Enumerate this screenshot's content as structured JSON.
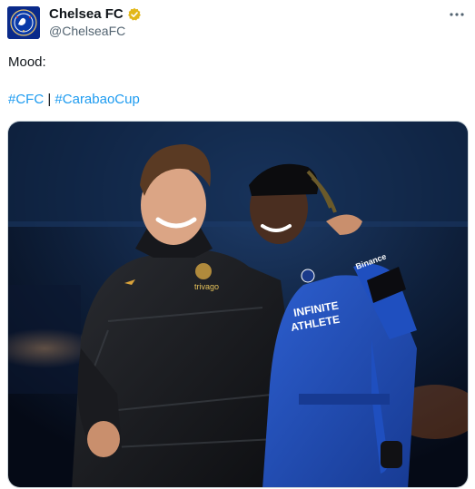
{
  "tweet": {
    "author": {
      "display_name": "Chelsea FC",
      "handle": "@ChelseaFC",
      "verified": true,
      "avatar_icon": "chelsea-crest-icon"
    },
    "text": "Mood:",
    "hashtags": [
      "#CFC",
      "#CarabaoCup"
    ],
    "separator": "|",
    "more_icon": "more-options-icon",
    "photo": {
      "sponsor_text": "trivago",
      "shirt_sponsor_line1": "INFINITE",
      "shirt_sponsor_line2": "ATHLETE",
      "sleeve_sponsor": "Binance"
    }
  },
  "colors": {
    "accent": "#1d9bf0",
    "verified_gold": "#e2b719",
    "chelsea_blue": "#034694"
  }
}
